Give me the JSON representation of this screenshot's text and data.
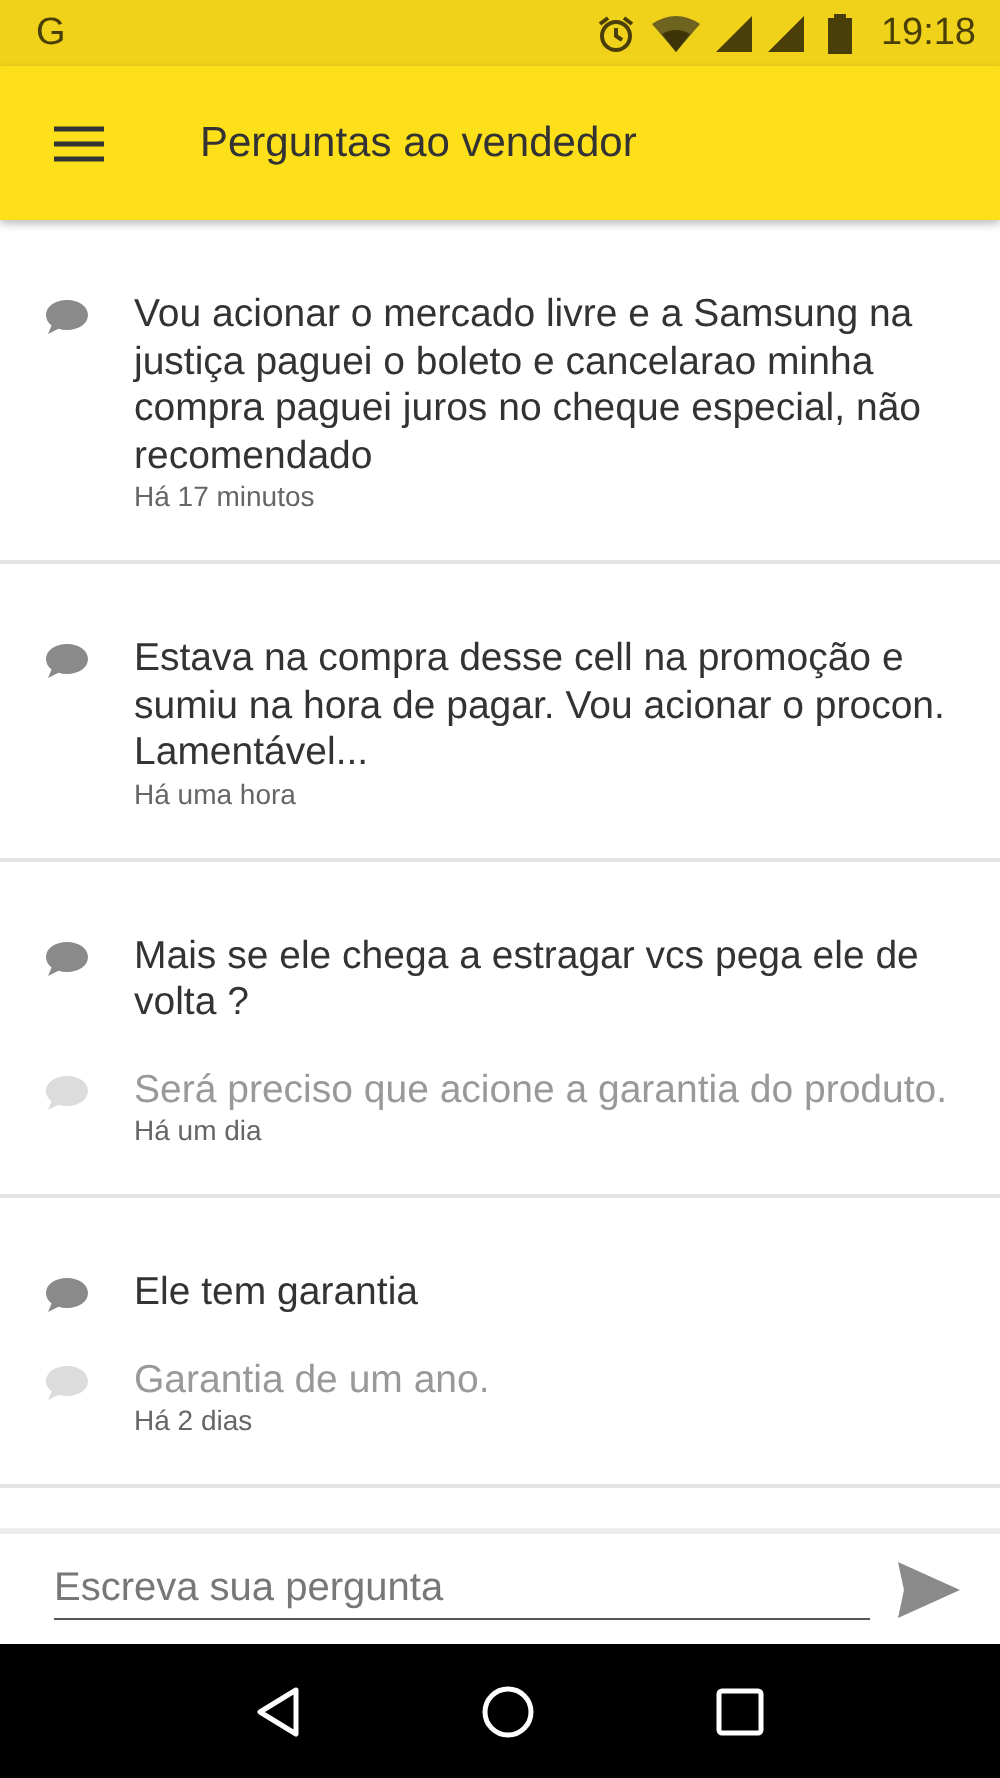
{
  "status_bar": {
    "notification": "G",
    "time": "19:18"
  },
  "app_bar": {
    "title": "Perguntas ao vendedor"
  },
  "threads": [
    {
      "entries": [
        {
          "kind": "question",
          "text": "Vou acionar o mercado livre e a Samsung na justiça paguei o boleto e cancelarao minha compra paguei juros no cheque especial, não recomendado"
        }
      ],
      "time": "Há 17 minutos"
    },
    {
      "entries": [
        {
          "kind": "question",
          "text": "Estava na compra desse cell na promoção e sumiu na hora de pagar. Vou acionar o procon. Lamentável..."
        }
      ],
      "time": "Há uma hora"
    },
    {
      "entries": [
        {
          "kind": "question",
          "text": "Mais se ele chega a estragar vcs pega ele de volta ?"
        },
        {
          "kind": "answer",
          "text": "Será preciso que acione a garantia do produto."
        }
      ],
      "time": "Há um dia"
    },
    {
      "entries": [
        {
          "kind": "question",
          "text": "Ele tem garantia"
        },
        {
          "kind": "answer",
          "text": "Garantia de um ano."
        }
      ],
      "time": "Há 2 dias"
    }
  ],
  "composer": {
    "placeholder": "Escreva sua pergunta"
  }
}
